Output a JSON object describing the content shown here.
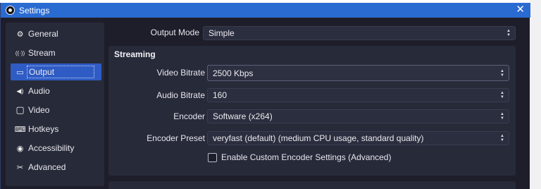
{
  "window": {
    "title": "Settings",
    "close_glyph": "✕"
  },
  "sidebar": {
    "items": [
      {
        "label": "General",
        "icon": "gear-icon",
        "glyph": "⚙",
        "active": false
      },
      {
        "label": "Stream",
        "icon": "broadcast-icon",
        "glyph": "((·))",
        "active": false
      },
      {
        "label": "Output",
        "icon": "output-icon",
        "glyph": "▭",
        "active": true
      },
      {
        "label": "Audio",
        "icon": "speaker-icon",
        "glyph": "◀)",
        "active": false
      },
      {
        "label": "Video",
        "icon": "monitor-icon",
        "glyph": "▢",
        "active": false
      },
      {
        "label": "Hotkeys",
        "icon": "keyboard-icon",
        "glyph": "⌨",
        "active": false
      },
      {
        "label": "Accessibility",
        "icon": "accessibility-icon",
        "glyph": "◉",
        "active": false
      },
      {
        "label": "Advanced",
        "icon": "tools-icon",
        "glyph": "✂",
        "active": false
      }
    ]
  },
  "output_mode": {
    "label": "Output Mode",
    "value": "Simple"
  },
  "streaming": {
    "title": "Streaming",
    "video_bitrate": {
      "label": "Video Bitrate",
      "value": "2500 Kbps"
    },
    "audio_bitrate": {
      "label": "Audio Bitrate",
      "value": "160"
    },
    "encoder": {
      "label": "Encoder",
      "value": "Software (x264)"
    },
    "encoder_preset": {
      "label": "Encoder Preset",
      "value": "veryfast (default) (medium CPU usage, standard quality)"
    },
    "custom_encoder": {
      "label": "Enable Custom Encoder Settings (Advanced)",
      "checked": false
    }
  },
  "colors": {
    "accent": "#2a6bd1",
    "active_item": "#2f5cc4",
    "background": "#1e1e2a",
    "panel": "#272a39"
  }
}
